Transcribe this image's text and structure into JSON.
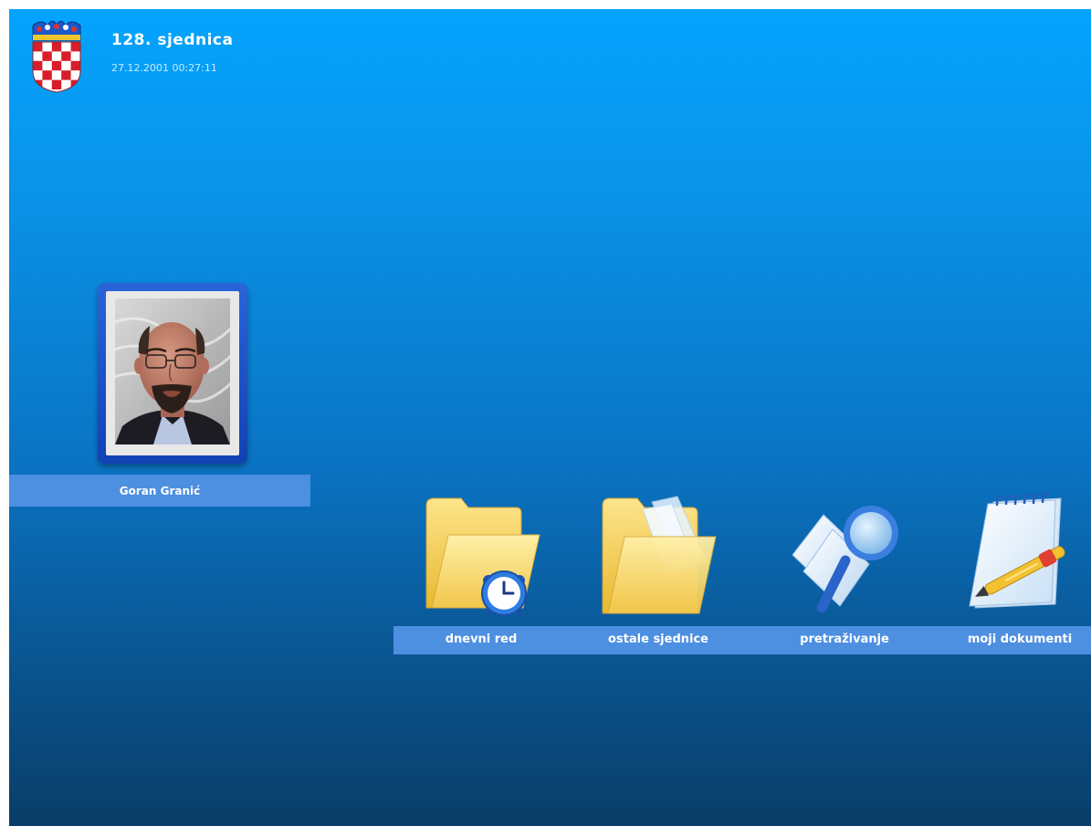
{
  "session": {
    "title": "128. sjednica",
    "datetime": "27.12.2001 00:27:11"
  },
  "profile": {
    "name": "Goran Granić"
  },
  "menu": {
    "items": [
      {
        "label": "dnevni red",
        "icon": "folder-clock-icon"
      },
      {
        "label": "ostale sjednice",
        "icon": "open-folder-icon"
      },
      {
        "label": "pretraživanje",
        "icon": "search-documents-icon"
      },
      {
        "label": "moji dokumenti",
        "icon": "notepad-pen-icon"
      }
    ]
  },
  "colors": {
    "background_top": "#04a4ff",
    "background_bottom": "#0a3d67",
    "label_bar": "#4d8fe0",
    "photo_frame": "#1a4fc4"
  }
}
